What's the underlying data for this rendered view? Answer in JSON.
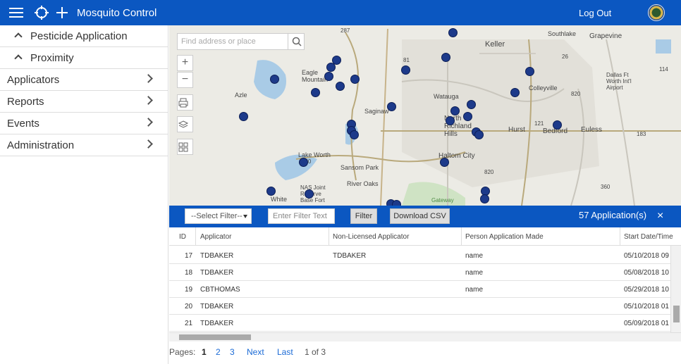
{
  "app": {
    "title": "Mosquito Control",
    "logout_label": "Log Out",
    "brand_color": "#0b57c1"
  },
  "sidebar": {
    "items": [
      {
        "label": "Pesticide Application",
        "expanded": true
      },
      {
        "label": "Proximity",
        "expanded": true
      },
      {
        "label": "Applicators"
      },
      {
        "label": "Reports"
      },
      {
        "label": "Events"
      },
      {
        "label": "Administration"
      }
    ]
  },
  "map": {
    "search_placeholder": "Find address or place",
    "labels": [
      "Keller",
      "Southlake",
      "Grapevine",
      "Eagle Mountain",
      "Azle",
      "Watauga",
      "Colleyville",
      "Saginaw",
      "North Richland Hills",
      "Hurst",
      "Bedford",
      "Euless",
      "Haltom City",
      "Lake Worth",
      "Sansom Park",
      "River Oaks",
      "NAS Joint Reserve Base Fort",
      "White",
      "Gateway",
      "Dallas Ft Worth Int'l Airport",
      "820",
      "820",
      "820",
      "26",
      "121",
      "360",
      "183",
      "114",
      "287",
      "81"
    ]
  },
  "filter": {
    "select_value": "--Select Filter--",
    "input_placeholder": "Enter Filter Text",
    "filter_label": "Filter",
    "download_label": "Download CSV",
    "count_label": "57 Application(s)",
    "close_label": "×"
  },
  "table": {
    "headers": [
      "ID",
      "Applicator",
      "Non-Licensed Applicator",
      "Person Application Made",
      "Start Date/Time"
    ],
    "rows": [
      [
        "17",
        "TDBAKER",
        "TDBAKER",
        "name",
        "05/10/2018 09"
      ],
      [
        "18",
        "TDBAKER",
        "",
        "name",
        "05/08/2018 10"
      ],
      [
        "19",
        "CBTHOMAS",
        "",
        "name",
        "05/29/2018 10"
      ],
      [
        "20",
        "TDBAKER",
        "",
        "",
        "05/10/2018 01"
      ],
      [
        "21",
        "TDBAKER",
        "",
        "",
        "05/09/2018 01"
      ]
    ]
  },
  "pager": {
    "prefix": "Pages:",
    "pages": [
      "1",
      "2",
      "3"
    ],
    "next": "Next",
    "last": "Last",
    "status": "1 of 3"
  }
}
